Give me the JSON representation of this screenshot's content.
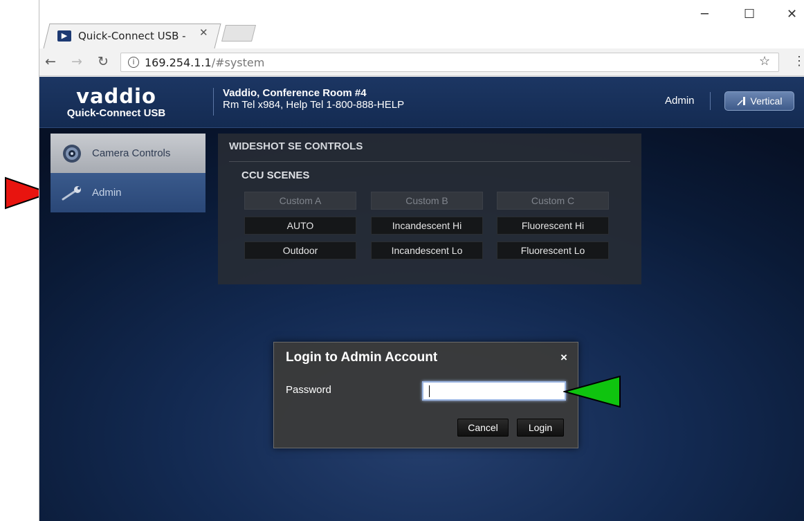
{
  "browser": {
    "tab_title": "Quick-Connect USB -",
    "favicon": "vaddio-arrow-icon",
    "url_host": "169.254.1.1",
    "url_rest": "/#system"
  },
  "header": {
    "logo_word": "vaddio",
    "logo_sub": "Quick-Connect USB",
    "room_line1": "Vaddio, Conference Room #4",
    "room_line2": "Rm Tel x984, Help Tel 1-800-888-HELP",
    "admin_label": "Admin",
    "vertical_label": "Vertical"
  },
  "sidebar": {
    "items": [
      {
        "label": "Camera Controls",
        "icon": "camera-lens-icon"
      },
      {
        "label": "Admin",
        "icon": "wrench-icon"
      }
    ]
  },
  "controls": {
    "title": "WIDESHOT SE CONTROLS",
    "ccu_title": "CCU SCENES",
    "scenes": [
      [
        "Custom A",
        "Custom B",
        "Custom C"
      ],
      [
        "AUTO",
        "Incandescent Hi",
        "Fluorescent Hi"
      ],
      [
        "Outdoor",
        "Incandescent Lo",
        "Fluorescent Lo"
      ]
    ]
  },
  "modal": {
    "title": "Login to Admin Account",
    "close": "×",
    "password_label": "Password",
    "password_value": "",
    "cancel": "Cancel",
    "login": "Login"
  },
  "annotations": {
    "red_arrow_color": "#e8140f",
    "green_arrow_color": "#0fc40f"
  }
}
